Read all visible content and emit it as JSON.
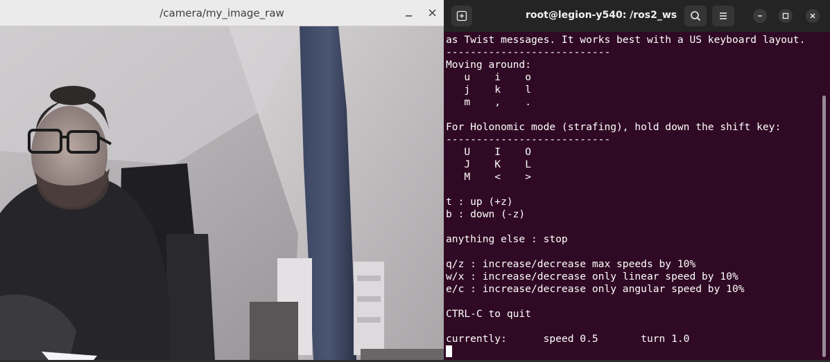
{
  "camera_window": {
    "title": "/camera/my_image_raw",
    "buttons": {
      "minimize_icon": "minimize-icon",
      "close_icon": "close-icon"
    }
  },
  "terminal": {
    "title": "root@legion-y540: /ros2_ws",
    "icons": [
      "new-tab-icon",
      "search-icon",
      "hamburger-menu-icon",
      "minimize-icon",
      "maximize-icon",
      "close-icon"
    ],
    "lines": [
      "as Twist messages. It works best with a US keyboard layout.",
      "---------------------------",
      "Moving around:",
      "   u    i    o",
      "   j    k    l",
      "   m    ,    .",
      "",
      "For Holonomic mode (strafing), hold down the shift key:",
      "---------------------------",
      "   U    I    O",
      "   J    K    L",
      "   M    <    >",
      "",
      "t : up (+z)",
      "b : down (-z)",
      "",
      "anything else : stop",
      "",
      "q/z : increase/decrease max speeds by 10%",
      "w/x : increase/decrease only linear speed by 10%",
      "e/c : increase/decrease only angular speed by 10%",
      "",
      "CTRL-C to quit",
      "",
      "currently:      speed 0.5       turn 1.0"
    ]
  },
  "colors": {
    "terminal_bg": "#300a24",
    "terminal_header": "#242424",
    "camera_titlebar": "#ebebeb"
  }
}
